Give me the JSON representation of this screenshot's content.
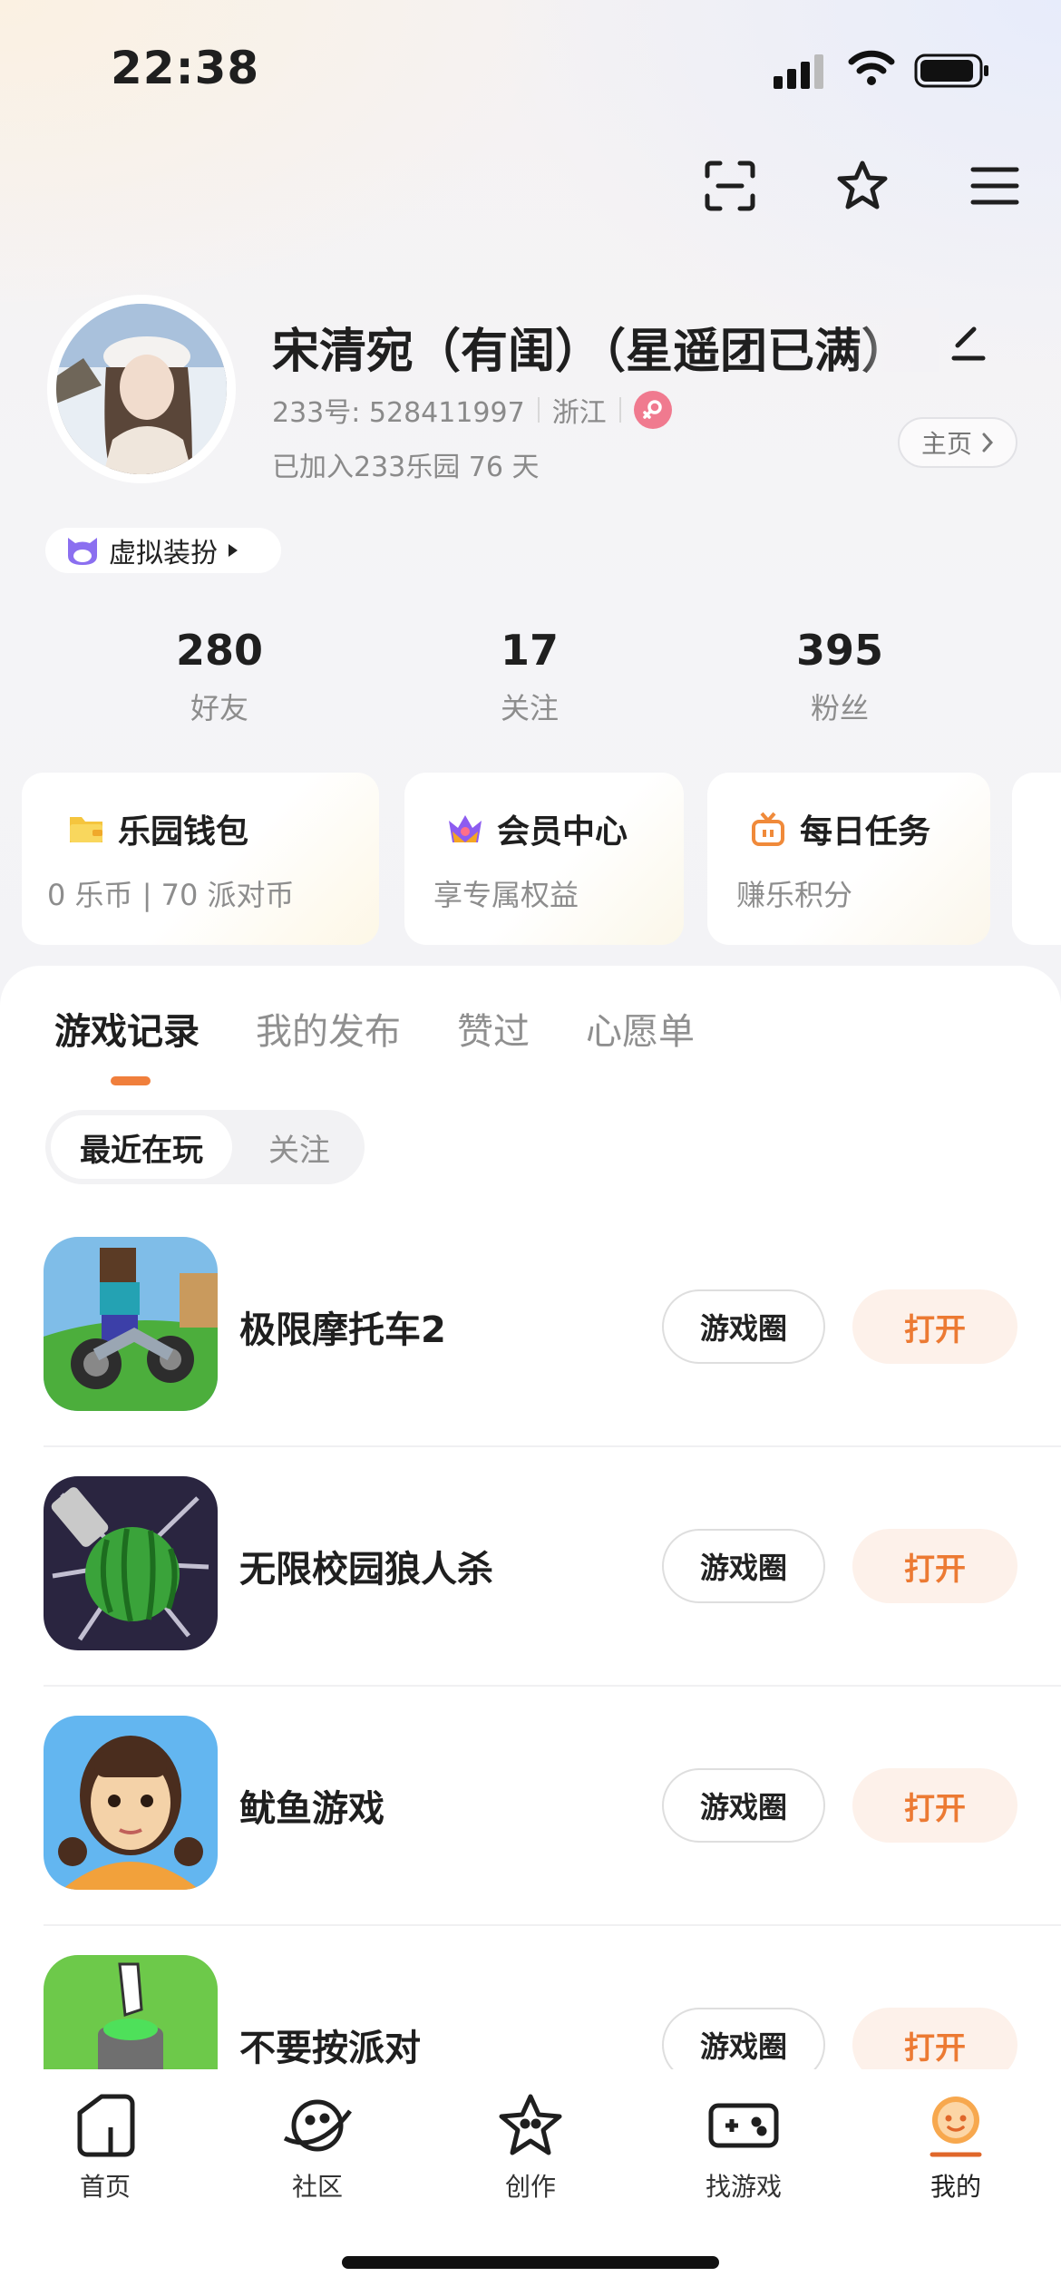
{
  "status_bar": {
    "time": "22:38"
  },
  "profile": {
    "name": "宋清宛（有闺）（星遥团已满）",
    "id_line": "233号: 528411997",
    "location": "浙江",
    "joined": "已加入233乐园 76 天",
    "homepage_label": "主页",
    "virtual_dress_label": "虚拟装扮"
  },
  "stats": [
    {
      "value": "280",
      "label": "好友"
    },
    {
      "value": "17",
      "label": "关注"
    },
    {
      "value": "395",
      "label": "粉丝"
    }
  ],
  "cards": [
    {
      "title": "乐园钱包",
      "subtitle": "0 乐币 | 70 派对币",
      "icon": "folder-wallet-icon"
    },
    {
      "title": "会员中心",
      "subtitle": "享专属权益",
      "icon": "crown-icon"
    },
    {
      "title": "每日任务",
      "subtitle": "赚乐积分",
      "icon": "gift-icon"
    }
  ],
  "tabs": [
    "游戏记录",
    "我的发布",
    "赞过",
    "心愿单"
  ],
  "segment": {
    "active": "最近在玩",
    "other": "关注"
  },
  "games": [
    {
      "name": "极限摩托车2",
      "circle_label": "游戏圈",
      "open_label": "打开"
    },
    {
      "name": "无限校园狼人杀",
      "circle_label": "游戏圈",
      "open_label": "打开"
    },
    {
      "name": "鱿鱼游戏",
      "circle_label": "游戏圈",
      "open_label": "打开"
    },
    {
      "name": "不要按派对",
      "circle_label": "游戏圈",
      "open_label": "打开"
    }
  ],
  "nav": [
    {
      "label": "首页",
      "icon": "home-icon"
    },
    {
      "label": "社区",
      "icon": "planet-icon"
    },
    {
      "label": "创作",
      "icon": "star-icon"
    },
    {
      "label": "找游戏",
      "icon": "gamepad-icon"
    },
    {
      "label": "我的",
      "icon": "profile-face-icon"
    }
  ],
  "colors": {
    "accent": "#ec7a33",
    "open_bg": "#fdf1ea",
    "gender": "#f07a8f"
  }
}
